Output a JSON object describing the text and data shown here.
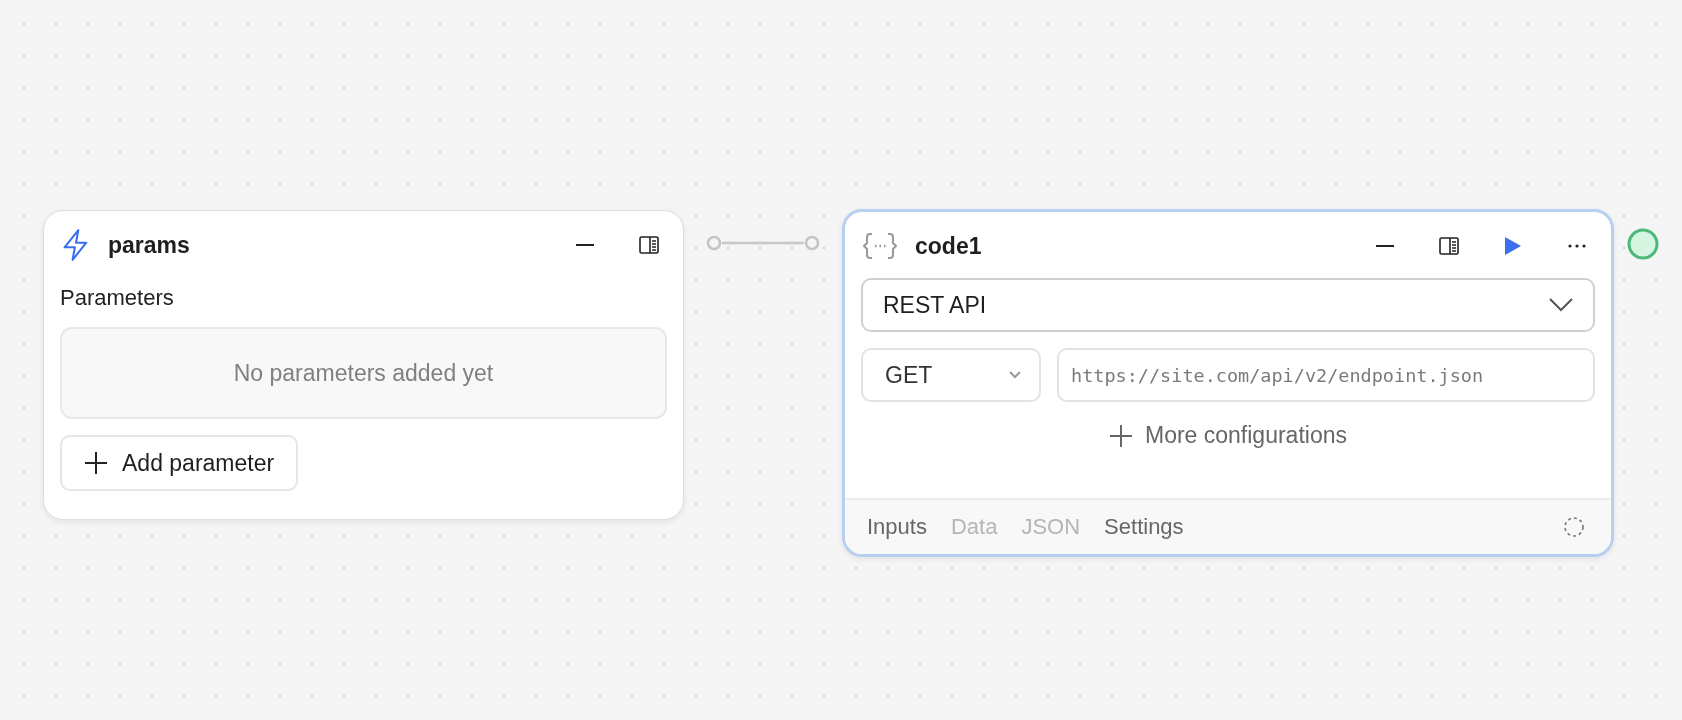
{
  "params_node": {
    "title": "params",
    "selected": false,
    "section_label": "Parameters",
    "empty_message": "No parameters added yet",
    "add_button": "Add parameter"
  },
  "code_node": {
    "title": "code1",
    "selected": true,
    "source": "REST API",
    "method": "GET",
    "url": {
      "placeholder": "https://site.com/api/v2/endpoint.json"
    },
    "more_button": "More configurations",
    "tabs": [
      {
        "label": "Inputs",
        "disabled": false
      },
      {
        "label": "Data",
        "disabled": true
      },
      {
        "label": "JSON",
        "disabled": true
      },
      {
        "label": "Settings",
        "disabled": false
      }
    ]
  }
}
